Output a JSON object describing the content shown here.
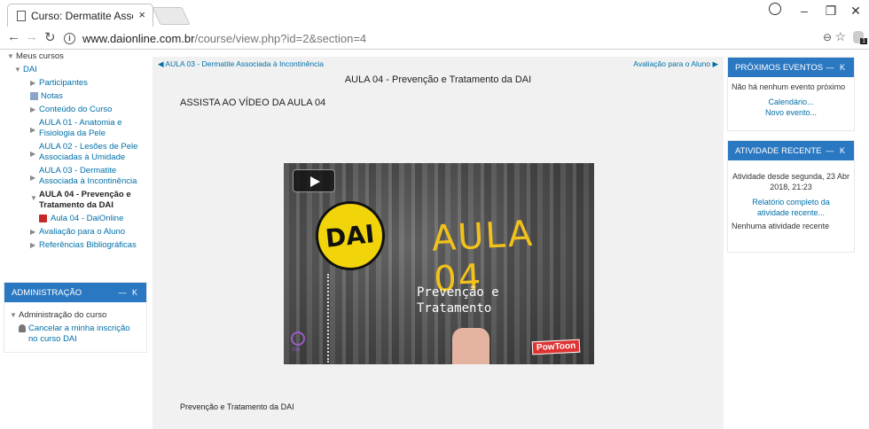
{
  "browser": {
    "tab_title": "Curso: Dermatite Associa",
    "tab_close": "×",
    "url_host": "www.daionline.com.br",
    "url_path": "/course/view.php?id=2&section=4",
    "extension_badge": "1",
    "icons": [
      "document-icon",
      "back-icon",
      "forward-icon",
      "reload-icon",
      "info-icon",
      "zoom-icon",
      "star-icon",
      "profile-icon"
    ]
  },
  "sidebar": {
    "items": [
      {
        "label": "Meus cursos",
        "kind": "dark"
      },
      {
        "label": "DAI",
        "kind": "link"
      },
      {
        "label": "Participantes",
        "kind": "link"
      },
      {
        "label": "Notas",
        "kind": "link"
      },
      {
        "label": "Conteúdo do Curso",
        "kind": "link"
      },
      {
        "label": "AULA 01 - Anatomia e Fisiologia da Pele",
        "kind": "link"
      },
      {
        "label": "AULA 02 - Lesões de Pele Associadas à Umidade",
        "kind": "link"
      },
      {
        "label": "AULA 03 - Dermatite Associada à Incontinência",
        "kind": "link"
      },
      {
        "label": "AULA 04 - Prevenção e Tratamento da DAI",
        "kind": "active"
      },
      {
        "label": "Aula 04 - DaiOnline",
        "kind": "link"
      },
      {
        "label": "Avaliação para o Aluno",
        "kind": "link"
      },
      {
        "label": "Referências Bibliográficas",
        "kind": "link"
      }
    ]
  },
  "admin": {
    "title": "ADMINISTRAÇÃO",
    "controls": "— K",
    "course_admin": "Administração do curso",
    "unenrol": "Cancelar a minha inscrição no curso DAI"
  },
  "main": {
    "prev_link": "◀ AULA 03 - Dermatite Associada à Incontinência",
    "next_link": "Avaliação para o Aluno ▶",
    "section_title": "AULA 04 - Prevenção e Tratamento da DAI",
    "watch_heading": "ASSISTA AO VÍDEO DA AULA 04",
    "video": {
      "badge": "DAI",
      "title": "AULA 04",
      "subtitle_1": "Prevenção e",
      "subtitle_2": "Tratamento",
      "brand": "PowToon",
      "logo_text": "DAI"
    },
    "caption": "Prevenção e Tratamento da DAI"
  },
  "events": {
    "title": "PRÓXIMOS EVENTOS",
    "controls": "— K",
    "empty": "Não há nenhum evento próximo",
    "calendar_link": "Calendário...",
    "new_event_link": "Novo evento..."
  },
  "activity": {
    "title": "ATIVIDADE RECENTE",
    "controls": "— K",
    "since": "Atividade desde segunda, 23 Abr 2018, 21:23",
    "report_link": "Relatório completo da atividade recente...",
    "none": "Nenhuma atividade recente"
  }
}
